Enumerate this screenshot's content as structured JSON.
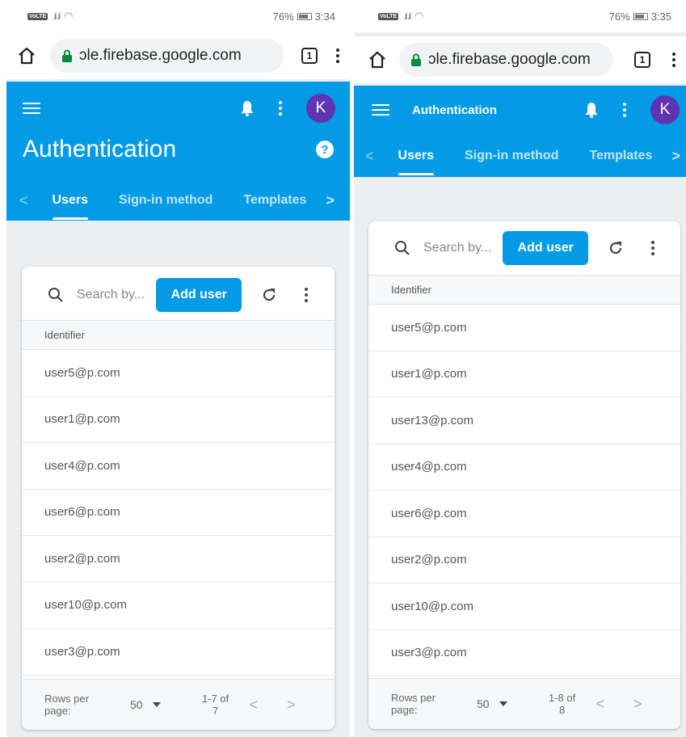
{
  "screens": [
    {
      "status": {
        "network": "VoLTE",
        "battery": "76%",
        "time": "3:34"
      },
      "url": "ɔle.firebase.google.com",
      "tab_count": "1",
      "title": "Authentication",
      "avatar_letter": "K",
      "tabs": [
        "Users",
        "Sign-in method",
        "Templates"
      ],
      "search_placeholder": "Search by...",
      "add_user": "Add user",
      "column": "Identifier",
      "users": [
        "user5@p.com",
        "user1@p.com",
        "user4@p.com",
        "user6@p.com",
        "user2@p.com",
        "user10@p.com",
        "user3@p.com"
      ],
      "rows_per_page_label": "Rows per page:",
      "rows_per_page": "50",
      "range": "1-7 of 7"
    },
    {
      "status": {
        "network": "VoLTE",
        "battery": "76%",
        "time": "3:35"
      },
      "url": "ɔle.firebase.google.com",
      "tab_count": "1",
      "title": "Authentication",
      "avatar_letter": "K",
      "tabs": [
        "Users",
        "Sign-in method",
        "Templates"
      ],
      "search_placeholder": "Search by...",
      "add_user": "Add user",
      "column": "Identifier",
      "users": [
        "user5@p.com",
        "user1@p.com",
        "user13@p.com",
        "user4@p.com",
        "user6@p.com",
        "user2@p.com",
        "user10@p.com",
        "user3@p.com"
      ],
      "rows_per_page_label": "Rows per page:",
      "rows_per_page": "50",
      "range": "1-8 of 8"
    }
  ],
  "colors": {
    "primary": "#039be5",
    "avatar": "#5e35b1",
    "background": "#eceff1"
  },
  "icons": [
    "home-icon",
    "lock-icon",
    "tabs-icon",
    "menu-icon",
    "bell-icon",
    "help-icon",
    "search-icon",
    "refresh-icon",
    "chevron-left-icon",
    "chevron-right-icon",
    "dropdown-icon"
  ]
}
